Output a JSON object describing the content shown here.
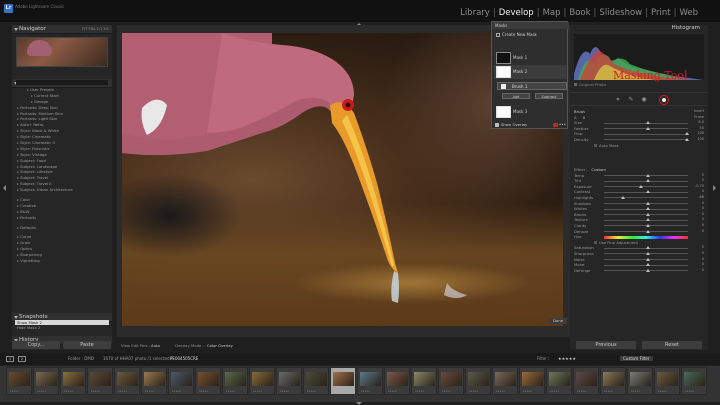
{
  "app": {
    "logo": "Lr",
    "name": "Adobe Lightroom Classic"
  },
  "modules": [
    "Library",
    "Develop",
    "Map",
    "Book",
    "Slideshow",
    "Print",
    "Web"
  ],
  "active_module": "Develop",
  "left": {
    "navigator": "Navigator",
    "nav_zoom": "FIT   FILL   1:1   3:1",
    "presets": "Presets",
    "preset_items": [
      {
        "t": "User Presets",
        "c": "sub"
      },
      {
        "t": "Current Start",
        "c": "sub2"
      },
      {
        "t": "George",
        "c": "sub2"
      },
      {
        "t": "Portraits: Deep Skin",
        "c": ""
      },
      {
        "t": "Portraits: Medium Skin",
        "c": ""
      },
      {
        "t": "Portraits: Light Skin",
        "c": ""
      },
      {
        "t": "Auto+ Retro",
        "c": ""
      },
      {
        "t": "Style: Black & White",
        "c": ""
      },
      {
        "t": "Style: Cinematic",
        "c": ""
      },
      {
        "t": "Style: Cinematic II",
        "c": ""
      },
      {
        "t": "Style: Futuristic",
        "c": ""
      },
      {
        "t": "Style: Vintage",
        "c": ""
      },
      {
        "t": "Subject: Food",
        "c": ""
      },
      {
        "t": "Subject: Landscape",
        "c": ""
      },
      {
        "t": "Subject: Lifestyle",
        "c": ""
      },
      {
        "t": "Subject: Travel",
        "c": ""
      },
      {
        "t": "Subject: Travel II",
        "c": ""
      },
      {
        "t": "Subject: Urban Architecture",
        "c": ""
      },
      {
        "t": "Color",
        "c": "gap"
      },
      {
        "t": "Creative",
        "c": ""
      },
      {
        "t": "B&W",
        "c": ""
      },
      {
        "t": "Portraits",
        "c": ""
      },
      {
        "t": "Defaults",
        "c": "gap"
      },
      {
        "t": "Curve",
        "c": "gap"
      },
      {
        "t": "Grain",
        "c": ""
      },
      {
        "t": "Optics",
        "c": ""
      },
      {
        "t": "Sharpening",
        "c": ""
      },
      {
        "t": "Vignetting",
        "c": ""
      }
    ],
    "snapshots": "Snapshots",
    "history": "History",
    "history_items": [
      "Show Mask 2",
      "Hide Mask 2"
    ],
    "copy": "Copy...",
    "paste": "Paste"
  },
  "masks": {
    "title": "Masks",
    "create": "Create New Mask",
    "mask1": "Mask 1",
    "mask2": "Mask 2",
    "brush": "Brush 1",
    "add": "Add",
    "subtract": "Subtract",
    "mask3": "Mask 3",
    "overlay": "Show Overlay",
    "overlay_color": "#c8251e",
    "done": "Done"
  },
  "toolbar": {
    "view": "View Edit Pins :",
    "view_val": "Auto",
    "overlay_mode": "Overlay Mode :",
    "overlay_val": "Color Overlay"
  },
  "right": {
    "histogram": "Histogram",
    "original": "Original Photo",
    "annotation": "Masking Tool",
    "annotation_color": "#d81e1e",
    "brush_title": "Brush",
    "invert": "Invert",
    "erase": "Erase",
    "brush_rows": [
      {
        "l": "Size",
        "v": "8.0",
        "k": 0.5
      },
      {
        "l": "Feather",
        "v": "50",
        "k": 0.5
      },
      {
        "l": "Flow",
        "v": "100",
        "k": 0.97
      },
      {
        "l": "Density",
        "v": "100",
        "k": 0.97
      }
    ],
    "automask": "Auto Mask",
    "effect": "Effect :",
    "effect_val": "Custom",
    "effect_rows": [
      {
        "l": "Temp",
        "v": "0",
        "k": 0.5
      },
      {
        "l": "Tint",
        "v": "0",
        "k": 0.5
      },
      {
        "l": "Exposure",
        "v": "-0.70",
        "k": 0.42
      },
      {
        "l": "Contrast",
        "v": "0",
        "k": 0.5
      },
      {
        "l": "Highlights",
        "v": "-66",
        "k": 0.2
      },
      {
        "l": "Shadows",
        "v": "0",
        "k": 0.5
      },
      {
        "l": "Whites",
        "v": "0",
        "k": 0.5
      },
      {
        "l": "Blacks",
        "v": "0",
        "k": 0.5
      },
      {
        "l": "Texture",
        "v": "0",
        "k": 0.5
      },
      {
        "l": "Clarity",
        "v": "0",
        "k": 0.5
      },
      {
        "l": "Dehaze",
        "v": "0",
        "k": 0.5
      }
    ],
    "hue": "Hue",
    "use_fine": "Use Fine Adjustment",
    "effect_rows2": [
      {
        "l": "Saturation",
        "v": "0",
        "k": 0.5
      },
      {
        "l": "Sharpness",
        "v": "0",
        "k": 0.5
      },
      {
        "l": "Noise",
        "v": "0",
        "k": 0.5
      },
      {
        "l": "Moire",
        "v": "0",
        "k": 0.5
      },
      {
        "l": "Defringe",
        "v": "0",
        "k": 0.5
      }
    ],
    "previous": "Previous",
    "reset": "Reset"
  },
  "filmbar": {
    "b1": "1",
    "b2": "2",
    "folder": "Folder : DMD",
    "count": "1670 of HHA07 photo /1 selected /",
    "file": "PE004505CRE",
    "filter": "Filter :",
    "filter_val": "Custom Filter"
  }
}
